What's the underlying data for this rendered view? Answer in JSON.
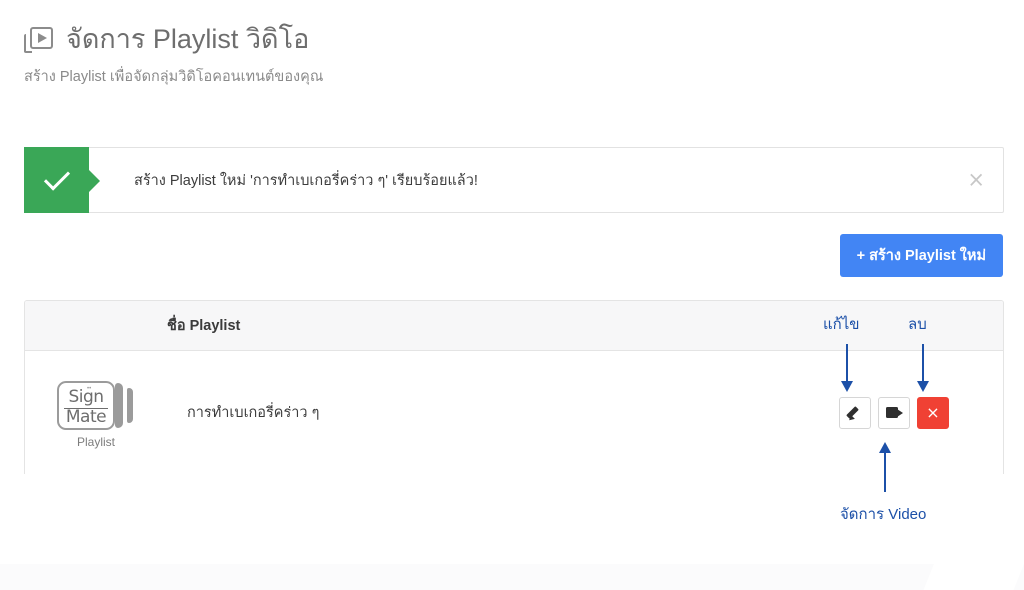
{
  "header": {
    "icon": "video-library-icon",
    "title": "จัดการ Playlist วิดิโอ",
    "subtitle": "สร้าง Playlist เพื่อจัดกลุ่มวิดิโอคอนเทนต์ของคุณ"
  },
  "alert": {
    "type": "success",
    "icon": "check-icon",
    "message": "สร้าง Playlist ใหม่ 'การทำเบเกอรี่คร่าว ๆ' เรียบร้อยแล้ว!",
    "close_label": "×",
    "bg_color": "#3aa757"
  },
  "toolbar": {
    "create_label": "+ สร้าง Playlist ใหม่",
    "create_color": "#4285f4"
  },
  "table": {
    "columns": [
      "",
      "ชื่อ Playlist",
      ""
    ],
    "header_name": "ชื่อ Playlist",
    "rows": [
      {
        "thumbnail": {
          "brand_line1": "Sign",
          "brand_line2": "Mate",
          "caption": "Playlist"
        },
        "name": "การทำเบเกอรี่คร่าว ๆ",
        "actions": [
          {
            "name": "edit-button",
            "icon": "pencil-icon",
            "style": "default"
          },
          {
            "name": "manage-video-button",
            "icon": "video-camera-icon",
            "style": "default"
          },
          {
            "name": "delete-button",
            "icon": "close-icon",
            "label": "×",
            "style": "danger",
            "color": "#f04134"
          }
        ]
      }
    ]
  },
  "annotations": {
    "color": "#1c50a8",
    "edit": "แก้ไข",
    "delete": "ลบ",
    "manage_video": "จัดการ Video"
  }
}
